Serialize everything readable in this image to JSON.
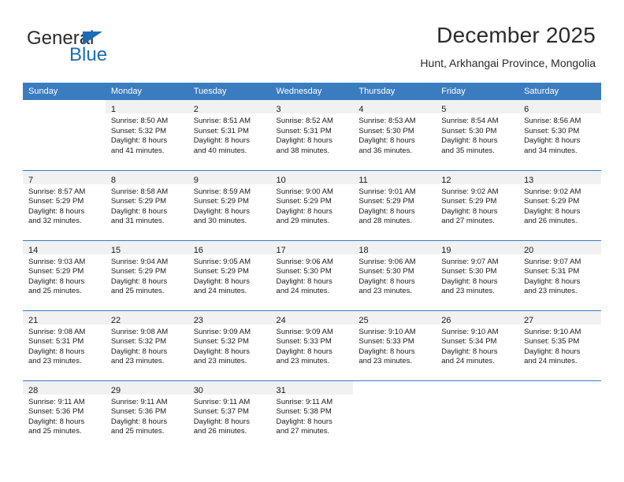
{
  "brand": {
    "name_part1": "General",
    "name_part2": "Blue",
    "triangle_color": "#1b6cb5"
  },
  "header": {
    "title": "December 2025",
    "subtitle": "Hunt, Arkhangai Province, Mongolia"
  },
  "theme": {
    "header_blue": "#3a7cc0",
    "daynum_band": "#f1f1f1",
    "text": "#1a1a1a"
  },
  "weekday_headers": [
    "Sunday",
    "Monday",
    "Tuesday",
    "Wednesday",
    "Thursday",
    "Friday",
    "Saturday"
  ],
  "labels": {
    "sunrise_prefix": "Sunrise:",
    "sunset_prefix": "Sunset:",
    "daylight_prefix": "Daylight:"
  },
  "weeks": [
    [
      {
        "day": "",
        "blank": true
      },
      {
        "day": "1",
        "sunrise": "Sunrise: 8:50 AM",
        "sunset": "Sunset: 5:32 PM",
        "daylight1": "Daylight: 8 hours",
        "daylight2": "and 41 minutes."
      },
      {
        "day": "2",
        "sunrise": "Sunrise: 8:51 AM",
        "sunset": "Sunset: 5:31 PM",
        "daylight1": "Daylight: 8 hours",
        "daylight2": "and 40 minutes."
      },
      {
        "day": "3",
        "sunrise": "Sunrise: 8:52 AM",
        "sunset": "Sunset: 5:31 PM",
        "daylight1": "Daylight: 8 hours",
        "daylight2": "and 38 minutes."
      },
      {
        "day": "4",
        "sunrise": "Sunrise: 8:53 AM",
        "sunset": "Sunset: 5:30 PM",
        "daylight1": "Daylight: 8 hours",
        "daylight2": "and 36 minutes."
      },
      {
        "day": "5",
        "sunrise": "Sunrise: 8:54 AM",
        "sunset": "Sunset: 5:30 PM",
        "daylight1": "Daylight: 8 hours",
        "daylight2": "and 35 minutes."
      },
      {
        "day": "6",
        "sunrise": "Sunrise: 8:56 AM",
        "sunset": "Sunset: 5:30 PM",
        "daylight1": "Daylight: 8 hours",
        "daylight2": "and 34 minutes."
      }
    ],
    [
      {
        "day": "7",
        "sunrise": "Sunrise: 8:57 AM",
        "sunset": "Sunset: 5:29 PM",
        "daylight1": "Daylight: 8 hours",
        "daylight2": "and 32 minutes."
      },
      {
        "day": "8",
        "sunrise": "Sunrise: 8:58 AM",
        "sunset": "Sunset: 5:29 PM",
        "daylight1": "Daylight: 8 hours",
        "daylight2": "and 31 minutes."
      },
      {
        "day": "9",
        "sunrise": "Sunrise: 8:59 AM",
        "sunset": "Sunset: 5:29 PM",
        "daylight1": "Daylight: 8 hours",
        "daylight2": "and 30 minutes."
      },
      {
        "day": "10",
        "sunrise": "Sunrise: 9:00 AM",
        "sunset": "Sunset: 5:29 PM",
        "daylight1": "Daylight: 8 hours",
        "daylight2": "and 29 minutes."
      },
      {
        "day": "11",
        "sunrise": "Sunrise: 9:01 AM",
        "sunset": "Sunset: 5:29 PM",
        "daylight1": "Daylight: 8 hours",
        "daylight2": "and 28 minutes."
      },
      {
        "day": "12",
        "sunrise": "Sunrise: 9:02 AM",
        "sunset": "Sunset: 5:29 PM",
        "daylight1": "Daylight: 8 hours",
        "daylight2": "and 27 minutes."
      },
      {
        "day": "13",
        "sunrise": "Sunrise: 9:02 AM",
        "sunset": "Sunset: 5:29 PM",
        "daylight1": "Daylight: 8 hours",
        "daylight2": "and 26 minutes."
      }
    ],
    [
      {
        "day": "14",
        "sunrise": "Sunrise: 9:03 AM",
        "sunset": "Sunset: 5:29 PM",
        "daylight1": "Daylight: 8 hours",
        "daylight2": "and 25 minutes."
      },
      {
        "day": "15",
        "sunrise": "Sunrise: 9:04 AM",
        "sunset": "Sunset: 5:29 PM",
        "daylight1": "Daylight: 8 hours",
        "daylight2": "and 25 minutes."
      },
      {
        "day": "16",
        "sunrise": "Sunrise: 9:05 AM",
        "sunset": "Sunset: 5:29 PM",
        "daylight1": "Daylight: 8 hours",
        "daylight2": "and 24 minutes."
      },
      {
        "day": "17",
        "sunrise": "Sunrise: 9:06 AM",
        "sunset": "Sunset: 5:30 PM",
        "daylight1": "Daylight: 8 hours",
        "daylight2": "and 24 minutes."
      },
      {
        "day": "18",
        "sunrise": "Sunrise: 9:06 AM",
        "sunset": "Sunset: 5:30 PM",
        "daylight1": "Daylight: 8 hours",
        "daylight2": "and 23 minutes."
      },
      {
        "day": "19",
        "sunrise": "Sunrise: 9:07 AM",
        "sunset": "Sunset: 5:30 PM",
        "daylight1": "Daylight: 8 hours",
        "daylight2": "and 23 minutes."
      },
      {
        "day": "20",
        "sunrise": "Sunrise: 9:07 AM",
        "sunset": "Sunset: 5:31 PM",
        "daylight1": "Daylight: 8 hours",
        "daylight2": "and 23 minutes."
      }
    ],
    [
      {
        "day": "21",
        "sunrise": "Sunrise: 9:08 AM",
        "sunset": "Sunset: 5:31 PM",
        "daylight1": "Daylight: 8 hours",
        "daylight2": "and 23 minutes."
      },
      {
        "day": "22",
        "sunrise": "Sunrise: 9:08 AM",
        "sunset": "Sunset: 5:32 PM",
        "daylight1": "Daylight: 8 hours",
        "daylight2": "and 23 minutes."
      },
      {
        "day": "23",
        "sunrise": "Sunrise: 9:09 AM",
        "sunset": "Sunset: 5:32 PM",
        "daylight1": "Daylight: 8 hours",
        "daylight2": "and 23 minutes."
      },
      {
        "day": "24",
        "sunrise": "Sunrise: 9:09 AM",
        "sunset": "Sunset: 5:33 PM",
        "daylight1": "Daylight: 8 hours",
        "daylight2": "and 23 minutes."
      },
      {
        "day": "25",
        "sunrise": "Sunrise: 9:10 AM",
        "sunset": "Sunset: 5:33 PM",
        "daylight1": "Daylight: 8 hours",
        "daylight2": "and 23 minutes."
      },
      {
        "day": "26",
        "sunrise": "Sunrise: 9:10 AM",
        "sunset": "Sunset: 5:34 PM",
        "daylight1": "Daylight: 8 hours",
        "daylight2": "and 24 minutes."
      },
      {
        "day": "27",
        "sunrise": "Sunrise: 9:10 AM",
        "sunset": "Sunset: 5:35 PM",
        "daylight1": "Daylight: 8 hours",
        "daylight2": "and 24 minutes."
      }
    ],
    [
      {
        "day": "28",
        "sunrise": "Sunrise: 9:11 AM",
        "sunset": "Sunset: 5:36 PM",
        "daylight1": "Daylight: 8 hours",
        "daylight2": "and 25 minutes."
      },
      {
        "day": "29",
        "sunrise": "Sunrise: 9:11 AM",
        "sunset": "Sunset: 5:36 PM",
        "daylight1": "Daylight: 8 hours",
        "daylight2": "and 25 minutes."
      },
      {
        "day": "30",
        "sunrise": "Sunrise: 9:11 AM",
        "sunset": "Sunset: 5:37 PM",
        "daylight1": "Daylight: 8 hours",
        "daylight2": "and 26 minutes."
      },
      {
        "day": "31",
        "sunrise": "Sunrise: 9:11 AM",
        "sunset": "Sunset: 5:38 PM",
        "daylight1": "Daylight: 8 hours",
        "daylight2": "and 27 minutes."
      },
      {
        "day": "",
        "blank": true
      },
      {
        "day": "",
        "blank": true
      },
      {
        "day": "",
        "blank": true
      }
    ]
  ]
}
